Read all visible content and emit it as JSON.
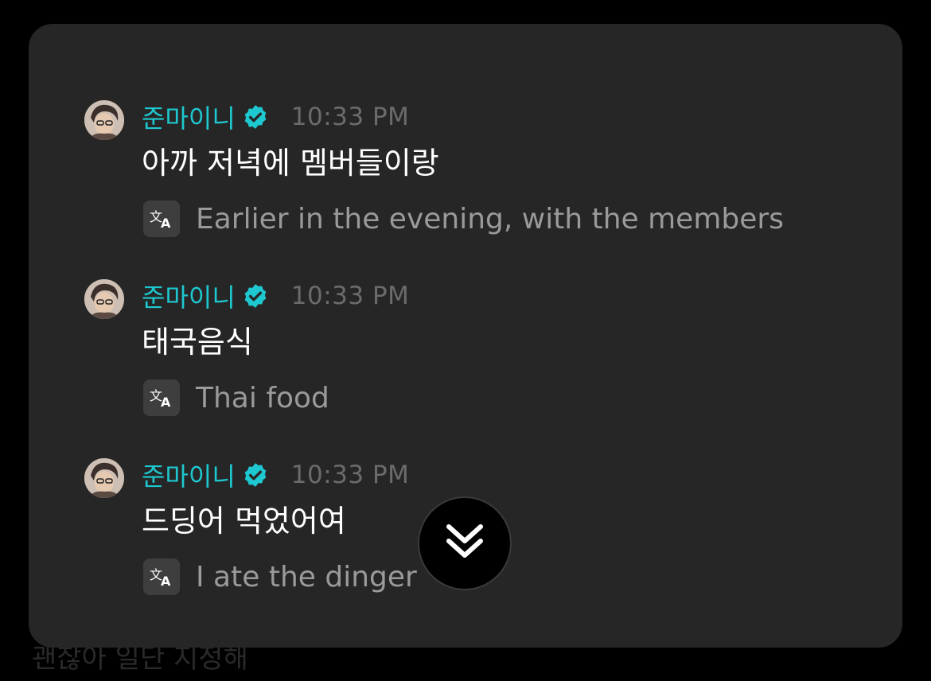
{
  "background_text": "괜찮아 일단 지정해",
  "messages": [
    {
      "sender": "준마이니",
      "time": "10:33 PM",
      "text": "아까 저녁에 멤버들이랑",
      "translation": "Earlier in the evening, with the members"
    },
    {
      "sender": "준마이니",
      "time": "10:33 PM",
      "text": "태국음식",
      "translation": "Thai food"
    },
    {
      "sender": "준마이니",
      "time": "10:33 PM",
      "text": "드딩어 먹었어여",
      "translation": "I ate the dinger"
    }
  ],
  "icons": {
    "verified": "verified-badge-icon",
    "translate": "translate-icon",
    "scroll_down": "double-chevron-down-icon"
  },
  "colors": {
    "accent": "#1ec8d0",
    "panel": "#262626",
    "time": "#6b6b6b",
    "translation": "#9a9a9a"
  }
}
